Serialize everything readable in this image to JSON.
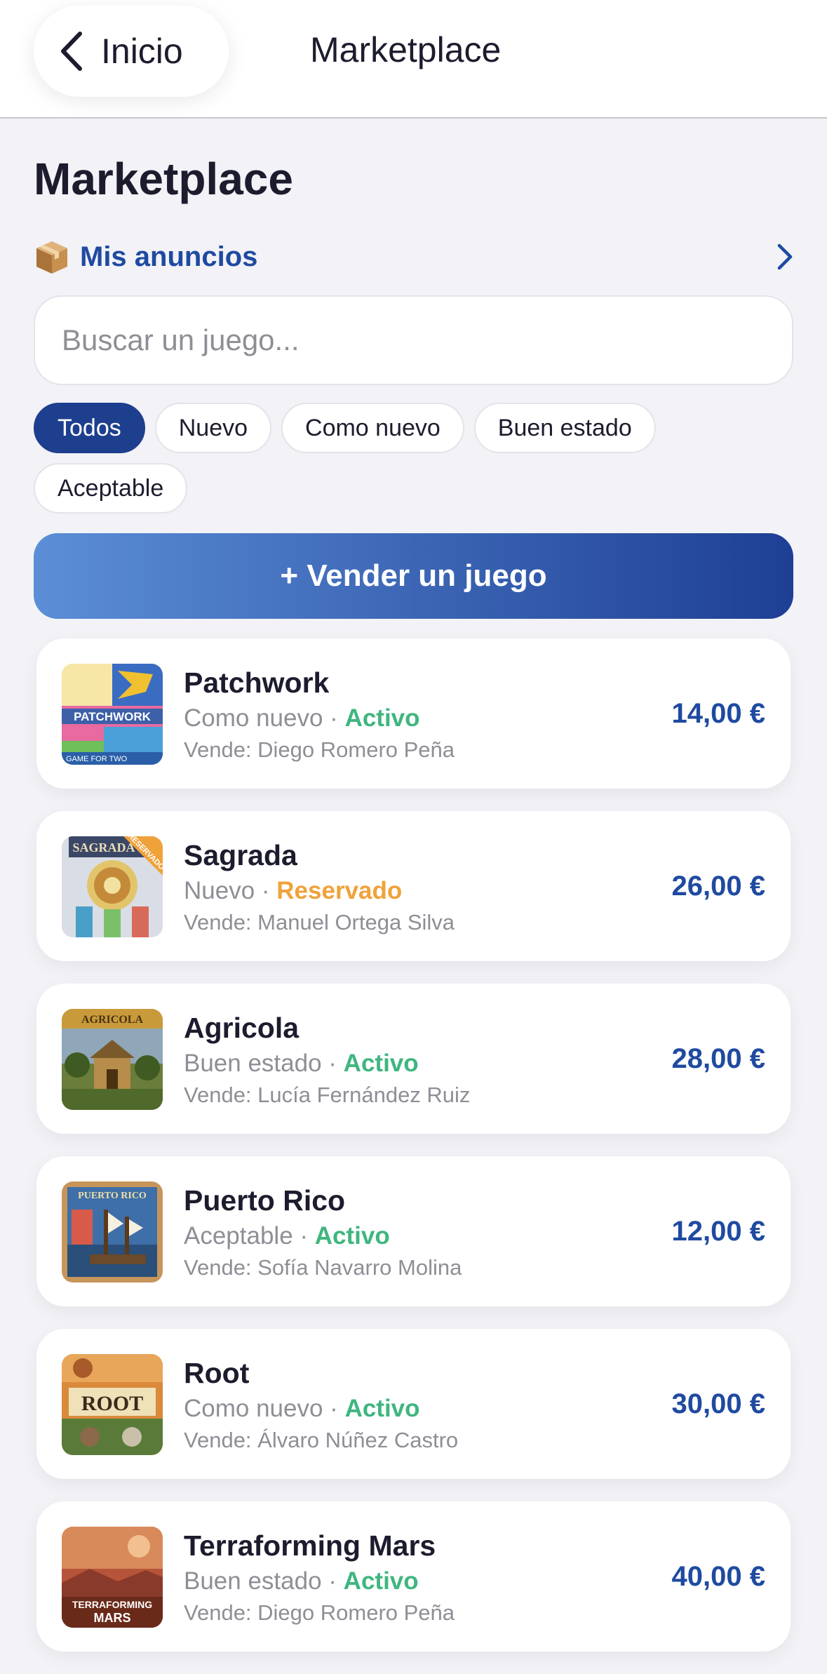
{
  "nav": {
    "back_label": "Inicio",
    "title": "Marketplace"
  },
  "page": {
    "title": "Marketplace"
  },
  "mis_anuncios": {
    "label": "Mis anuncios",
    "icon": "package-icon"
  },
  "search": {
    "placeholder": "Buscar un juego..."
  },
  "filters": [
    "Todos",
    "Nuevo",
    "Como nuevo",
    "Buen estado",
    "Aceptable"
  ],
  "active_filter": "Todos",
  "sell_button": {
    "label": "+ Vender un juego"
  },
  "colors": {
    "accent": "#1f4aa0",
    "active_chip": "#1e3f8e",
    "status_active": "#3fb67f",
    "status_reserved": "#f0a23a",
    "background": "#f2f2f7"
  },
  "listings": [
    {
      "title": "Patchwork",
      "condition": "Como nuevo",
      "separator": " · ",
      "status": "Activo",
      "status_color": "green",
      "seller": "Vende: Diego Romero Peña",
      "price": "14,00 €",
      "cover_text": "PATCHWORK",
      "cover_subtext": "GAME FOR TWO"
    },
    {
      "title": "Sagrada",
      "condition": "Nuevo",
      "separator": " · ",
      "status": "Reservado",
      "status_color": "orange",
      "seller": "Vende: Manuel Ortega Silva",
      "price": "26,00 €",
      "cover_text": "SAGRADA",
      "cover_subtext": "RESERVADO"
    },
    {
      "title": "Agricola",
      "condition": "Buen estado",
      "separator": " · ",
      "status": "Activo",
      "status_color": "green",
      "seller": "Vende: Lucía Fernández Ruiz",
      "price": "28,00 €",
      "cover_text": "AGRICOLA",
      "cover_subtext": ""
    },
    {
      "title": "Puerto Rico",
      "condition": "Aceptable",
      "separator": " · ",
      "status": "Activo",
      "status_color": "green",
      "seller": "Vende: Sofía Navarro Molina",
      "price": "12,00 €",
      "cover_text": "PUERTO RICO",
      "cover_subtext": ""
    },
    {
      "title": "Root",
      "condition": "Como nuevo",
      "separator": " · ",
      "status": "Activo",
      "status_color": "green",
      "seller": "Vende: Álvaro Núñez Castro",
      "price": "30,00 €",
      "cover_text": "ROOT",
      "cover_subtext": ""
    },
    {
      "title": "Terraforming Mars",
      "condition": "Buen estado",
      "separator": " · ",
      "status": "Activo",
      "status_color": "green",
      "seller": "Vende: Diego Romero Peña",
      "price": "40,00 €",
      "cover_text": "TERRAFORMING",
      "cover_subtext": "MARS"
    }
  ]
}
